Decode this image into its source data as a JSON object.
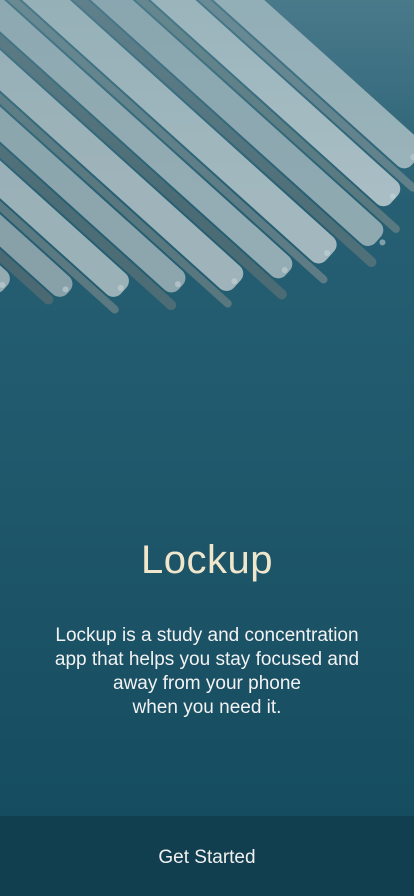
{
  "app": {
    "title": "Lockup",
    "description": "Lockup is a study and concentration\napp that helps you stay focused and\naway from your phone\nwhen you need it."
  },
  "hero": {
    "icon": "stacked-books-image"
  },
  "actions": {
    "get_started_label": "Get Started"
  },
  "colors": {
    "background": "#225b6f",
    "title": "#efe6cc",
    "button": "#113f50"
  }
}
